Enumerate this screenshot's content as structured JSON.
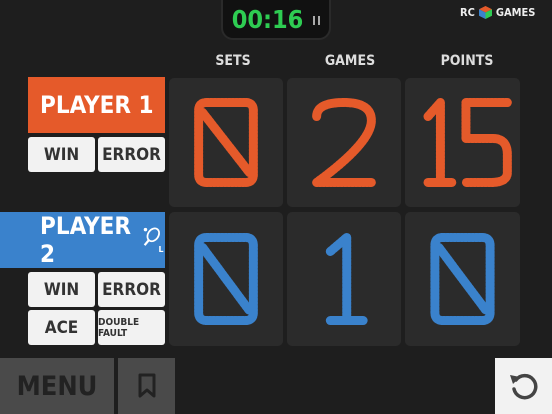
{
  "timer": {
    "time": "00:16",
    "pause_icon": "pause-icon"
  },
  "brand": {
    "left": "RC",
    "right": "GAMES"
  },
  "columns": [
    "SETS",
    "GAMES",
    "POINTS"
  ],
  "players": [
    {
      "name": "PLAYER 1",
      "color": "#e55a2a",
      "sets": "0",
      "games": "2",
      "points": "15",
      "buttons": {
        "win": "WIN",
        "error": "ERROR"
      }
    },
    {
      "name": "PLAYER 2",
      "color": "#3a82cc",
      "sets": "0",
      "games": "1",
      "points": "0",
      "serving": true,
      "serve_side": "L",
      "buttons": {
        "win": "WIN",
        "error": "ERROR",
        "ace": "ACE",
        "double_fault": "DOUBLE FAULT"
      }
    }
  ],
  "bottom_bar": {
    "menu": "MENU",
    "bookmark_icon": "bookmark-icon",
    "reset_icon": "undo-icon"
  },
  "colors": {
    "accent_green": "#2ecc52",
    "player1": "#e55a2a",
    "player2": "#3a82cc"
  }
}
